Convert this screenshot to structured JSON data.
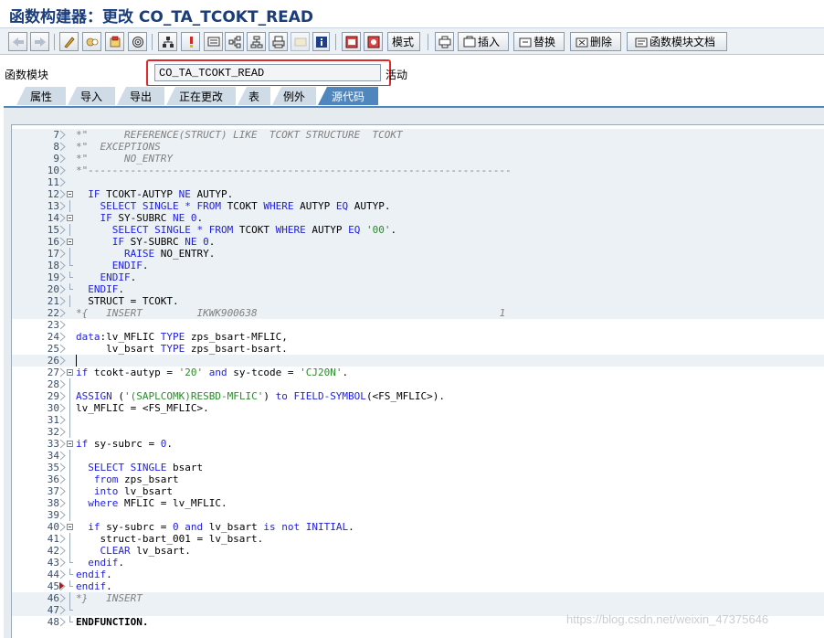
{
  "window": {
    "title": "函数构建器：更改 CO_TA_TCOKT_READ"
  },
  "toolbar": {
    "mode_label": "模式",
    "insert_label": "插入",
    "replace_label": "替换",
    "delete_label": "删除",
    "doc_label": "函数模块文档"
  },
  "function_module": {
    "label": "函数模块",
    "value": "CO_TA_TCOKT_READ",
    "status": "活动"
  },
  "tabs": [
    "属性",
    "导入",
    "导出",
    "正在更改",
    "表",
    "例外",
    "源代码"
  ],
  "active_tab": "源代码",
  "code_lines": [
    {
      "n": "7",
      "text": "*\"      REFERENCE(STRUCT) LIKE  TCOKT STRUCTURE  TCOKT",
      "type": "comment",
      "bg": true
    },
    {
      "n": "8",
      "text": "*\"  EXCEPTIONS",
      "type": "comment",
      "bg": true
    },
    {
      "n": "9",
      "text": "*\"      NO_ENTRY",
      "type": "comment",
      "bg": true
    },
    {
      "n": "10",
      "text": "*\"----------------------------------------------------------------------",
      "type": "comment",
      "bg": true
    },
    {
      "n": "11",
      "text": "",
      "type": "plain",
      "bg": true
    },
    {
      "n": "12",
      "text": "  IF TCOKT-AUTYP NE AUTYP.",
      "type": "plain",
      "bg": true
    },
    {
      "n": "13",
      "text": "    SELECT SINGLE * FROM TCOKT WHERE AUTYP EQ AUTYP.",
      "type": "plain",
      "bg": true
    },
    {
      "n": "14",
      "text": "    IF SY-SUBRC NE 0.",
      "type": "plain",
      "bg": true
    },
    {
      "n": "15",
      "text": "      SELECT SINGLE * FROM TCOKT WHERE AUTYP EQ '00'.",
      "type": "plain",
      "bg": true
    },
    {
      "n": "16",
      "text": "      IF SY-SUBRC NE 0.",
      "type": "plain",
      "bg": true
    },
    {
      "n": "17",
      "text": "        RAISE NO_ENTRY.",
      "type": "plain",
      "bg": true
    },
    {
      "n": "18",
      "text": "      ENDIF.",
      "type": "plain",
      "bg": true
    },
    {
      "n": "19",
      "text": "    ENDIF.",
      "type": "plain",
      "bg": true
    },
    {
      "n": "20",
      "text": "  ENDIF.",
      "type": "plain",
      "bg": true
    },
    {
      "n": "21",
      "text": "  STRUCT = TCOKT.",
      "type": "plain",
      "bg": true
    },
    {
      "n": "22",
      "text": "*{   INSERT         IKWK900638                                        1",
      "type": "comment",
      "bg": true
    },
    {
      "n": "23",
      "text": "",
      "type": "plain",
      "bg": false
    },
    {
      "n": "24",
      "text": "data:lv_MFLIC TYPE zps_bsart-MFLIC,",
      "type": "plain",
      "bg": false
    },
    {
      "n": "25",
      "text": "     lv_bsart TYPE zps_bsart-bsart.",
      "type": "plain",
      "bg": false
    },
    {
      "n": "26",
      "text": "",
      "type": "plain",
      "bg": true
    },
    {
      "n": "27",
      "text": "if tcokt-autyp = '20' and sy-tcode = 'CJ20N'.",
      "type": "plain",
      "bg": false
    },
    {
      "n": "28",
      "text": "",
      "type": "plain",
      "bg": false
    },
    {
      "n": "29",
      "text": "ASSIGN ('(SAPLCOMK)RESBD-MFLIC') to FIELD-SYMBOL(<FS_MFLIC>).",
      "type": "plain",
      "bg": false
    },
    {
      "n": "30",
      "text": "lv_MFLIC = <FS_MFLIC>.",
      "type": "plain",
      "bg": false
    },
    {
      "n": "31",
      "text": "",
      "type": "plain",
      "bg": false
    },
    {
      "n": "32",
      "text": "",
      "type": "plain",
      "bg": false
    },
    {
      "n": "33",
      "text": "if sy-subrc = 0.",
      "type": "plain",
      "bg": false
    },
    {
      "n": "34",
      "text": "",
      "type": "plain",
      "bg": false
    },
    {
      "n": "35",
      "text": "  SELECT SINGLE bsart",
      "type": "plain",
      "bg": false
    },
    {
      "n": "36",
      "text": "   from zps_bsart",
      "type": "plain",
      "bg": false
    },
    {
      "n": "37",
      "text": "   into lv_bsart",
      "type": "plain",
      "bg": false
    },
    {
      "n": "38",
      "text": "  where MFLIC = lv_MFLIC.",
      "type": "plain",
      "bg": false
    },
    {
      "n": "39",
      "text": "",
      "type": "plain",
      "bg": false
    },
    {
      "n": "40",
      "text": "  if sy-subrc = 0 and lv_bsart is not INITIAL.",
      "type": "plain",
      "bg": false
    },
    {
      "n": "41",
      "text": "    struct-bart_001 = lv_bsart.",
      "type": "plain",
      "bg": false
    },
    {
      "n": "42",
      "text": "    CLEAR lv_bsart.",
      "type": "plain",
      "bg": false
    },
    {
      "n": "43",
      "text": "  endif.",
      "type": "plain",
      "bg": false
    },
    {
      "n": "44",
      "text": "endif.",
      "type": "plain",
      "bg": false
    },
    {
      "n": "45",
      "text": "endif.",
      "type": "plain",
      "bg": false
    },
    {
      "n": "46",
      "text": "*}   INSERT",
      "type": "comment",
      "bg": true
    },
    {
      "n": "47",
      "text": "",
      "type": "plain",
      "bg": true
    },
    {
      "n": "48",
      "text": "ENDFUNCTION.",
      "type": "plain",
      "bg": false
    }
  ],
  "watermark": "https://blog.csdn.net/weixin_47375646",
  "colors": {
    "accent": "#4f86bd",
    "keyword": "#1e1ee0",
    "comment": "#808080",
    "string": "#2a8a2a",
    "highlight": "#e0292b"
  }
}
